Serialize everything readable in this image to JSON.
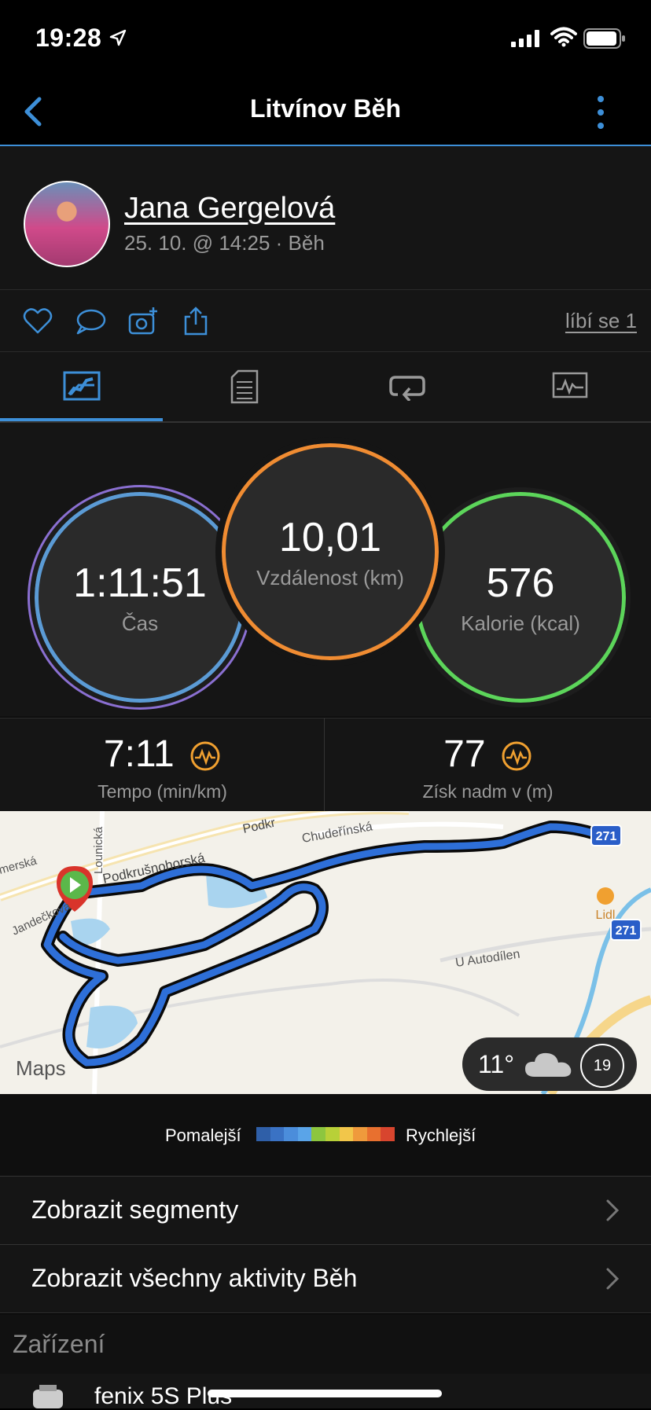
{
  "status": {
    "time": "19:28"
  },
  "nav": {
    "title": "Litvínov Běh"
  },
  "header": {
    "user_name": "Jana Gergelová",
    "meta": "25. 10. @ 14:25 · Běh"
  },
  "actions": {
    "likes_label": "líbí se 1"
  },
  "tabs": [
    {
      "name": "stats-tab",
      "icon": "stats-icon",
      "active": true
    },
    {
      "name": "details-tab",
      "icon": "document-icon",
      "active": false
    },
    {
      "name": "laps-tab",
      "icon": "loop-icon",
      "active": false
    },
    {
      "name": "charts-tab",
      "icon": "chart-icon",
      "active": false
    }
  ],
  "metrics": {
    "time": {
      "value": "1:11:51",
      "label": "Čas",
      "color": "#5b9bd5"
    },
    "distance": {
      "value": "10,01",
      "label": "Vzdálenost (km)",
      "color": "#f08c32"
    },
    "calories": {
      "value": "576",
      "label": "Kalorie (kcal)",
      "color": "#5cd55a"
    }
  },
  "stats": {
    "pace": {
      "value": "7:11",
      "label": "Tempo (min/km)"
    },
    "elevation": {
      "value": "77",
      "label": "Získ nadm v (m)"
    }
  },
  "map": {
    "streets": [
      "Podkrušnohorská",
      "Chudeřínská",
      "U Autodílen",
      "Jandečkova",
      "Lounická",
      "merská",
      "Podkr"
    ],
    "poi": "Lidl",
    "road_shields": [
      "271",
      "271"
    ],
    "attribution": "Maps",
    "weather": {
      "temp": "11°",
      "icon": "cloud-icon",
      "wind": "19"
    }
  },
  "legend": {
    "slow_label": "Pomalejší",
    "fast_label": "Rychlejší",
    "colors": [
      "#2f5fa8",
      "#3a72c4",
      "#4b8ddb",
      "#5aa4e8",
      "#8cc63f",
      "#b8d038",
      "#f2c64a",
      "#ef9a3c",
      "#e8702f",
      "#d8452e"
    ]
  },
  "rows": {
    "segments": "Zobrazit segmenty",
    "all_activities": "Zobrazit všechny aktivity Běh"
  },
  "devices": {
    "title": "Zařízení",
    "name": "fenix 5S Plus"
  }
}
